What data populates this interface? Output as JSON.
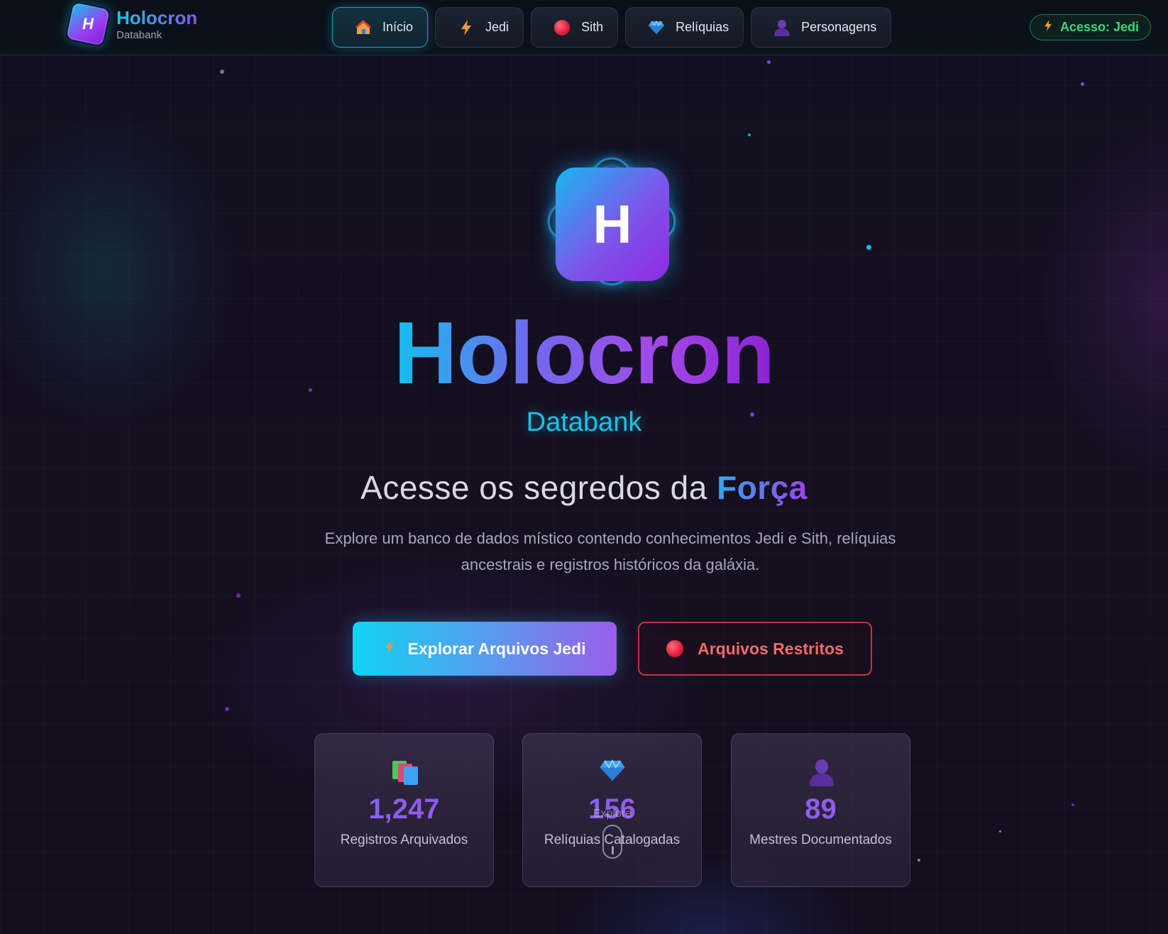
{
  "brand": {
    "logo_letter": "H",
    "title": "Holocron",
    "subtitle": "Databank"
  },
  "nav": {
    "tabs": [
      {
        "label": "Início",
        "icon": "house-icon",
        "active": true
      },
      {
        "label": "Jedi",
        "icon": "lightning-icon",
        "active": false
      },
      {
        "label": "Sith",
        "icon": "red-orb-icon",
        "active": false
      },
      {
        "label": "Relíquias",
        "icon": "gem-icon",
        "active": false
      },
      {
        "label": "Personagens",
        "icon": "person-icon",
        "active": false
      }
    ],
    "access_label": "Acesso: Jedi"
  },
  "hero": {
    "logo_letter": "H",
    "title": "Holocron",
    "subtitle": "Databank",
    "tagline_prefix": "Acesse os segredos da ",
    "tagline_highlight": "Força",
    "description": "Explore um banco de dados místico contendo conhecimentos Jedi e Sith, relíquias ancestrais e registros históricos da galáxia."
  },
  "buttons": {
    "primary_label": "Explorar Arquivos Jedi",
    "secondary_label": "Arquivos Restritos"
  },
  "stats": [
    {
      "icon": "books-icon",
      "value": "1,247",
      "label": "Registros Arquivados"
    },
    {
      "icon": "gem-icon",
      "value": "156",
      "label": "Relíquias Catalogadas"
    },
    {
      "icon": "person-icon",
      "value": "89",
      "label": "Mestres Documentados"
    }
  ],
  "scroll_hint": {
    "label": "Explore"
  },
  "colors": {
    "accent_cyan": "#16c6ee",
    "accent_purple": "#9a45e6",
    "danger": "#e0343d",
    "success": "#3fd47b"
  }
}
